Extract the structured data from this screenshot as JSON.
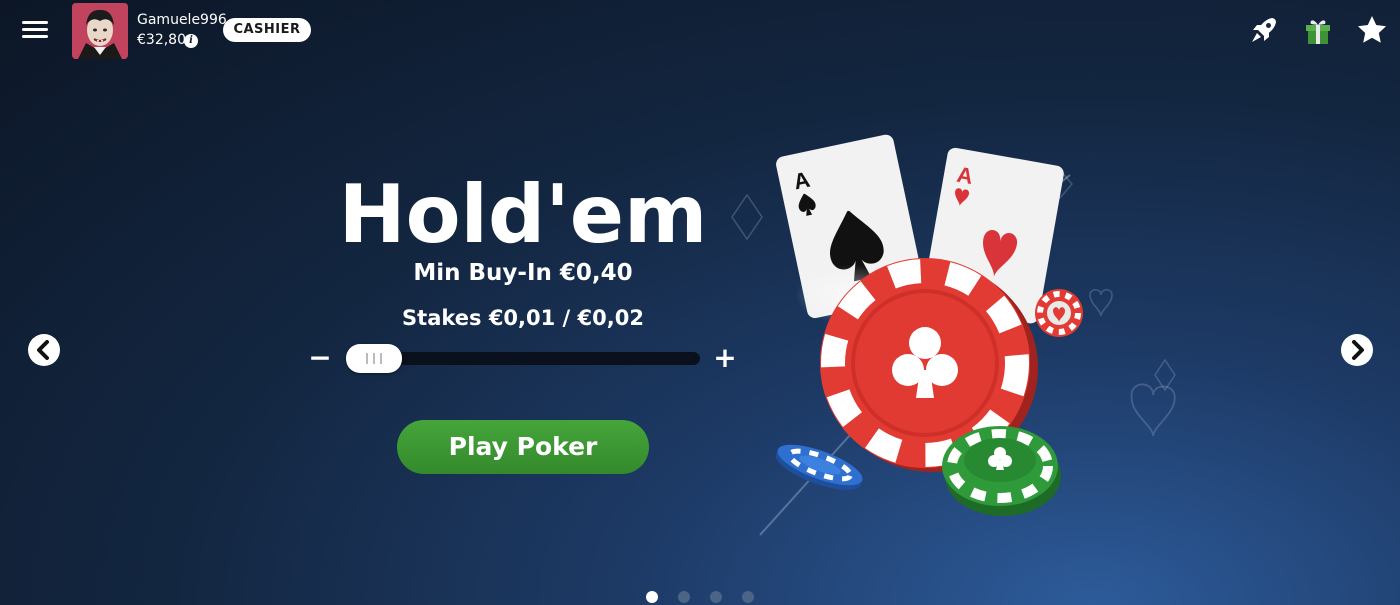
{
  "header": {
    "menu_icon": "hamburger-menu-icon",
    "avatar_icon": "player-avatar",
    "username": "Gamuele996",
    "balance": "€32,80",
    "info_icon_glyph": "i",
    "cashier_label": "CASHIER",
    "icons": [
      "rocket-icon",
      "gift-icon",
      "star-icon"
    ]
  },
  "hero": {
    "title": "Hold'em",
    "min_buyin": "Min Buy-In €0,40",
    "stakes": "Stakes €0,01 / €0,02",
    "stake_slider": {
      "minus_label": "−",
      "plus_label": "+",
      "position": 0
    },
    "play_label": "Play Poker"
  },
  "carousel": {
    "prev_icon": "chevron-left-icon",
    "next_icon": "chevron-right-icon",
    "slide_count": 4,
    "active_slide": 1
  },
  "art": {
    "cards": [
      {
        "rank": "A",
        "suit": "spades"
      },
      {
        "rank": "A",
        "suit": "hearts"
      }
    ]
  },
  "colors": {
    "play_button": "#3f9c35",
    "chip_red": "#e23b33",
    "chip_green": "#2e9a3a",
    "chip_blue": "#2f6fd0",
    "card_heart": "#d8343a"
  }
}
